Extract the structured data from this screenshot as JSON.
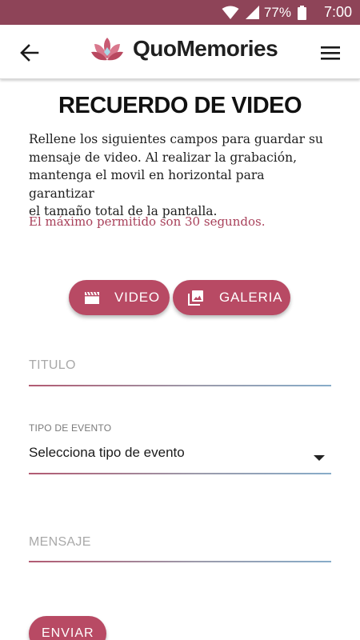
{
  "status_bar": {
    "battery_percent": "77%",
    "time": "7:00",
    "icons": [
      "wifi-icon",
      "signal-icon",
      "battery-icon"
    ]
  },
  "app_bar": {
    "brand": "QuoMemories",
    "icons": [
      "back-arrow-icon",
      "lotus-logo-icon",
      "hamburger-menu-icon"
    ]
  },
  "page": {
    "title": "RECUERDO DE VIDEO",
    "intro_lines": [
      "Rellene los siguientes campos para guardar su",
      "mensaje de video. Al realizar la grabación,",
      "mantenga el movil en horizontal para garantizar",
      "el tamaño total de la pantalla."
    ],
    "limit_notice": "El máximo permitido son 30 segundos."
  },
  "media_buttons": {
    "video_label": "VIDEO",
    "galeria_label": "GALERIA",
    "icons": [
      "movie-icon",
      "gallery-icon"
    ]
  },
  "form": {
    "titulo_placeholder": "TITULO",
    "tipo_evento_caption": "TIPO DE EVENTO",
    "tipo_evento_value": "Selecciona tipo de evento",
    "mensaje_placeholder": "MENSAJE",
    "submit_label": "ENVIAR"
  },
  "colors": {
    "status_bar": "#8e4458",
    "accent": "#b84a64",
    "notice_text": "#a8405a",
    "underline_start": "#b25a72",
    "underline_end": "#87acc9"
  }
}
